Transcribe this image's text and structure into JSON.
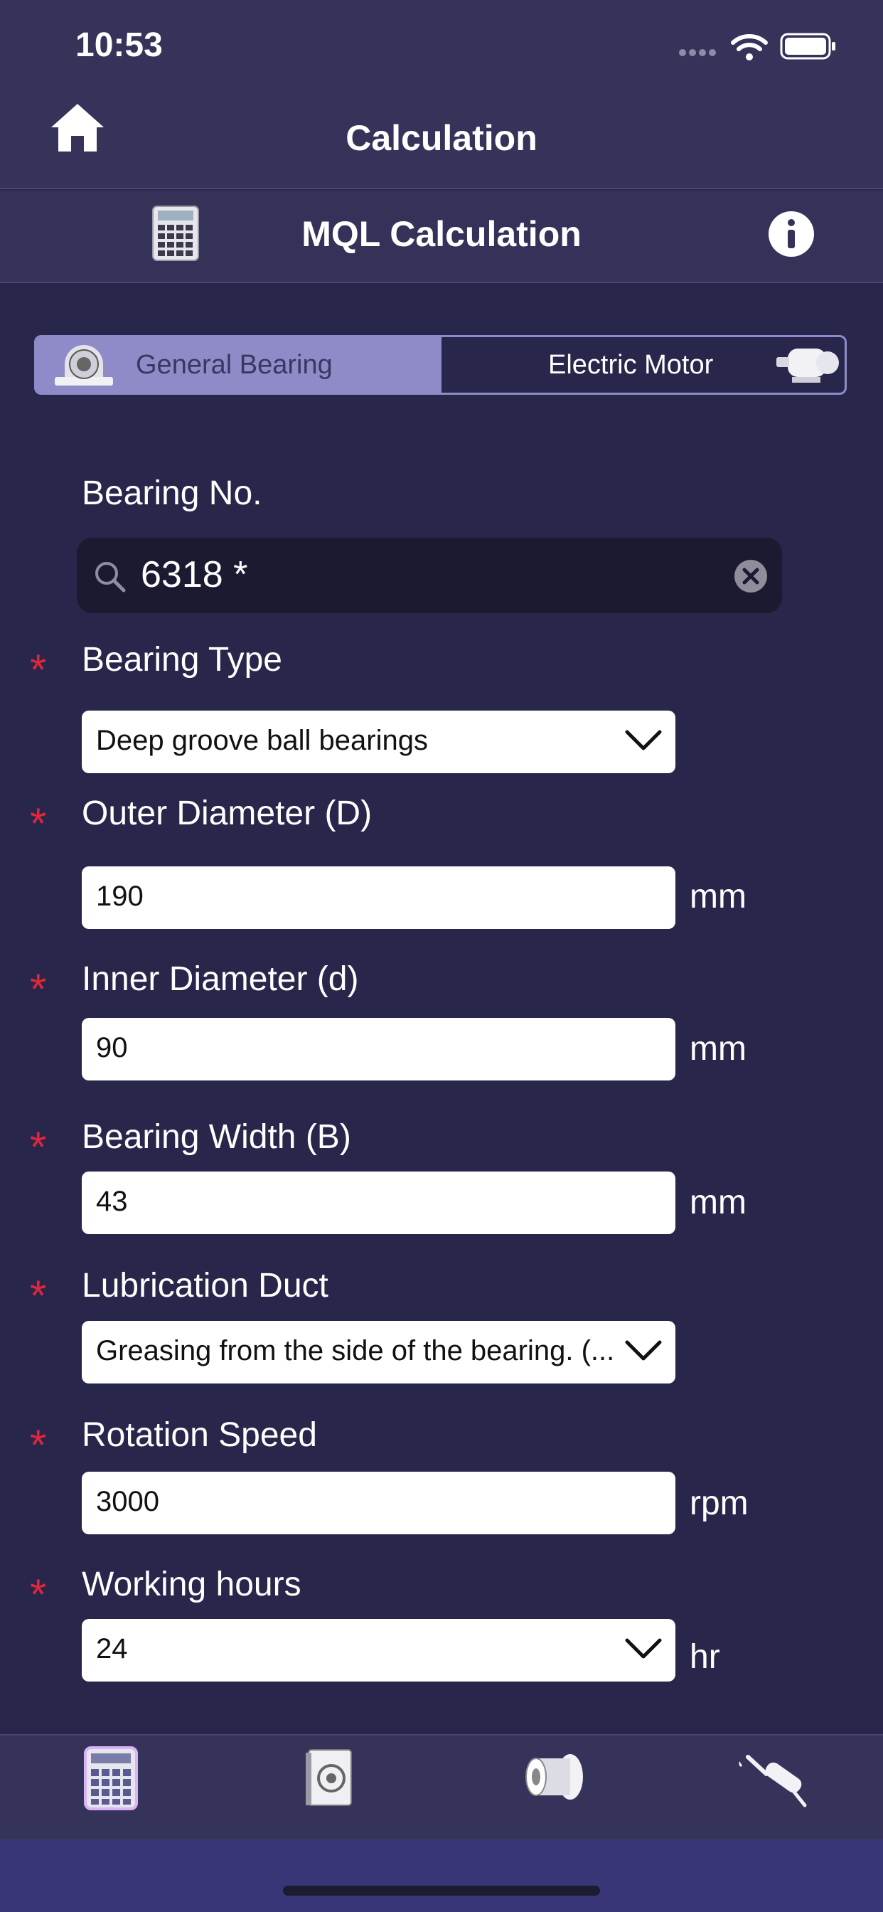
{
  "status": {
    "time": "10:53"
  },
  "header": {
    "title": "Calculation"
  },
  "subheader": {
    "title": "MQL Calculation"
  },
  "segment": {
    "left_label": "General Bearing",
    "right_label": "Electric Motor"
  },
  "form": {
    "bearing_no": {
      "label": "Bearing No.",
      "value": "6318 *"
    },
    "bearing_type": {
      "label": "Bearing Type",
      "value": "Deep groove ball bearings"
    },
    "outer_diameter": {
      "label": "Outer Diameter (D)",
      "value": "190",
      "unit": "mm"
    },
    "inner_diameter": {
      "label": "Inner Diameter (d)",
      "value": "90",
      "unit": "mm"
    },
    "bearing_width": {
      "label": "Bearing Width (B)",
      "value": "43",
      "unit": "mm"
    },
    "lubrication_duct": {
      "label": "Lubrication Duct",
      "value": "Greasing from the side of the bearing. (..."
    },
    "rotation_speed": {
      "label": "Rotation Speed",
      "value": "3000",
      "unit": "rpm"
    },
    "working_hours": {
      "label": "Working hours",
      "value": "24",
      "unit": "hr"
    },
    "required_mark": "*"
  },
  "tabbar": {
    "icons": [
      "calculator-icon",
      "bearing-book-icon",
      "bearing-cylinder-icon",
      "grease-gun-icon"
    ]
  },
  "colors": {
    "background": "#28264a",
    "header": "#35335a",
    "accent": "#8e8bc8",
    "required": "#e0263b"
  }
}
